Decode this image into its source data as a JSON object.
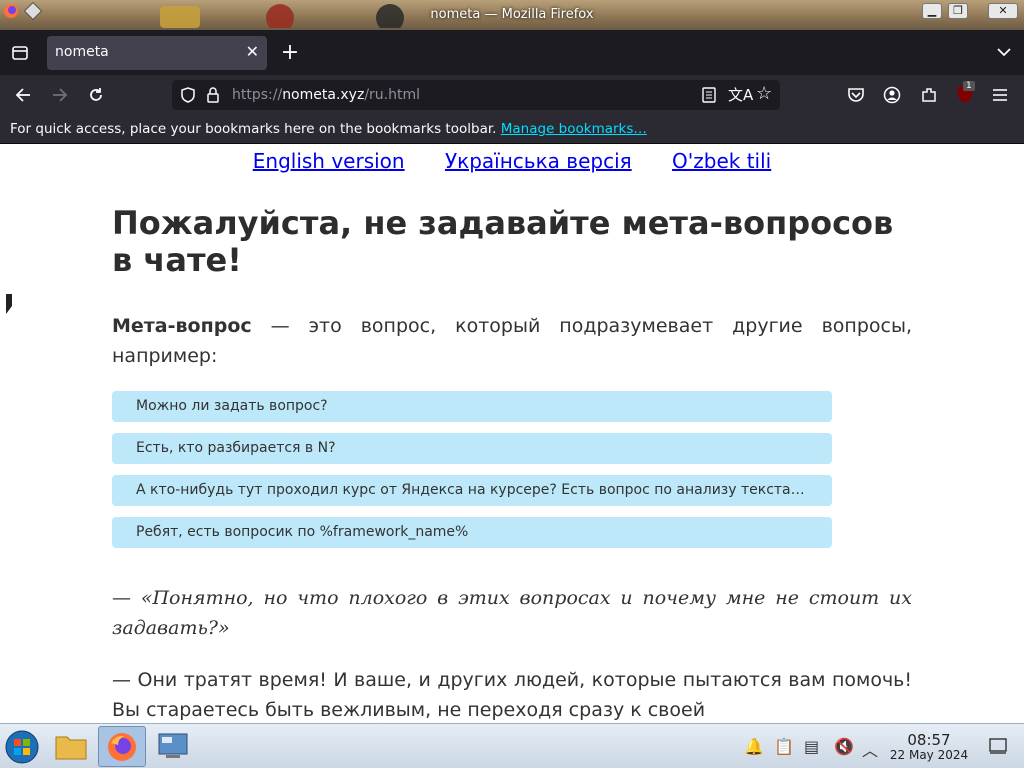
{
  "window": {
    "title": "nometa — Mozilla Firefox"
  },
  "tabs": [
    {
      "label": "nometa"
    }
  ],
  "navbar": {
    "url_scheme": "https://",
    "url_host": "nometa.xyz",
    "url_path": "/ru.html",
    "extension_badge": "1"
  },
  "bookmarks_bar": {
    "text": "For quick access, place your bookmarks here on the bookmarks toolbar.",
    "link": "Manage bookmarks…"
  },
  "page": {
    "languages": [
      "English version",
      "Українська версія",
      "O'zbek tili"
    ],
    "heading": "Пожалуйста, не задавайте мета-вопросов в чате!",
    "intro_bold": "Мета-вопрос",
    "intro_rest": " — это вопрос, который подразумевает другие вопросы, например:",
    "examples": [
      "Можно ли задать вопрос?",
      "Есть, кто разбирается в N?",
      "А кто-нибудь тут проходил курс от Яндекса на курсере? Есть вопрос по анализу текста…",
      "Ребят, есть вопросик по %framework_name%"
    ],
    "quote": "— «Понятно, но что плохого в этих вопросах и почему мне не стоит их задавать?»",
    "answer": "— Они тратят время! И ваше, и других людей, которые пытаются вам помочь! Вы стараетесь быть вежливым, не переходя сразу к своей"
  },
  "taskbar": {
    "time": "08:57",
    "date": "22 May 2024"
  }
}
